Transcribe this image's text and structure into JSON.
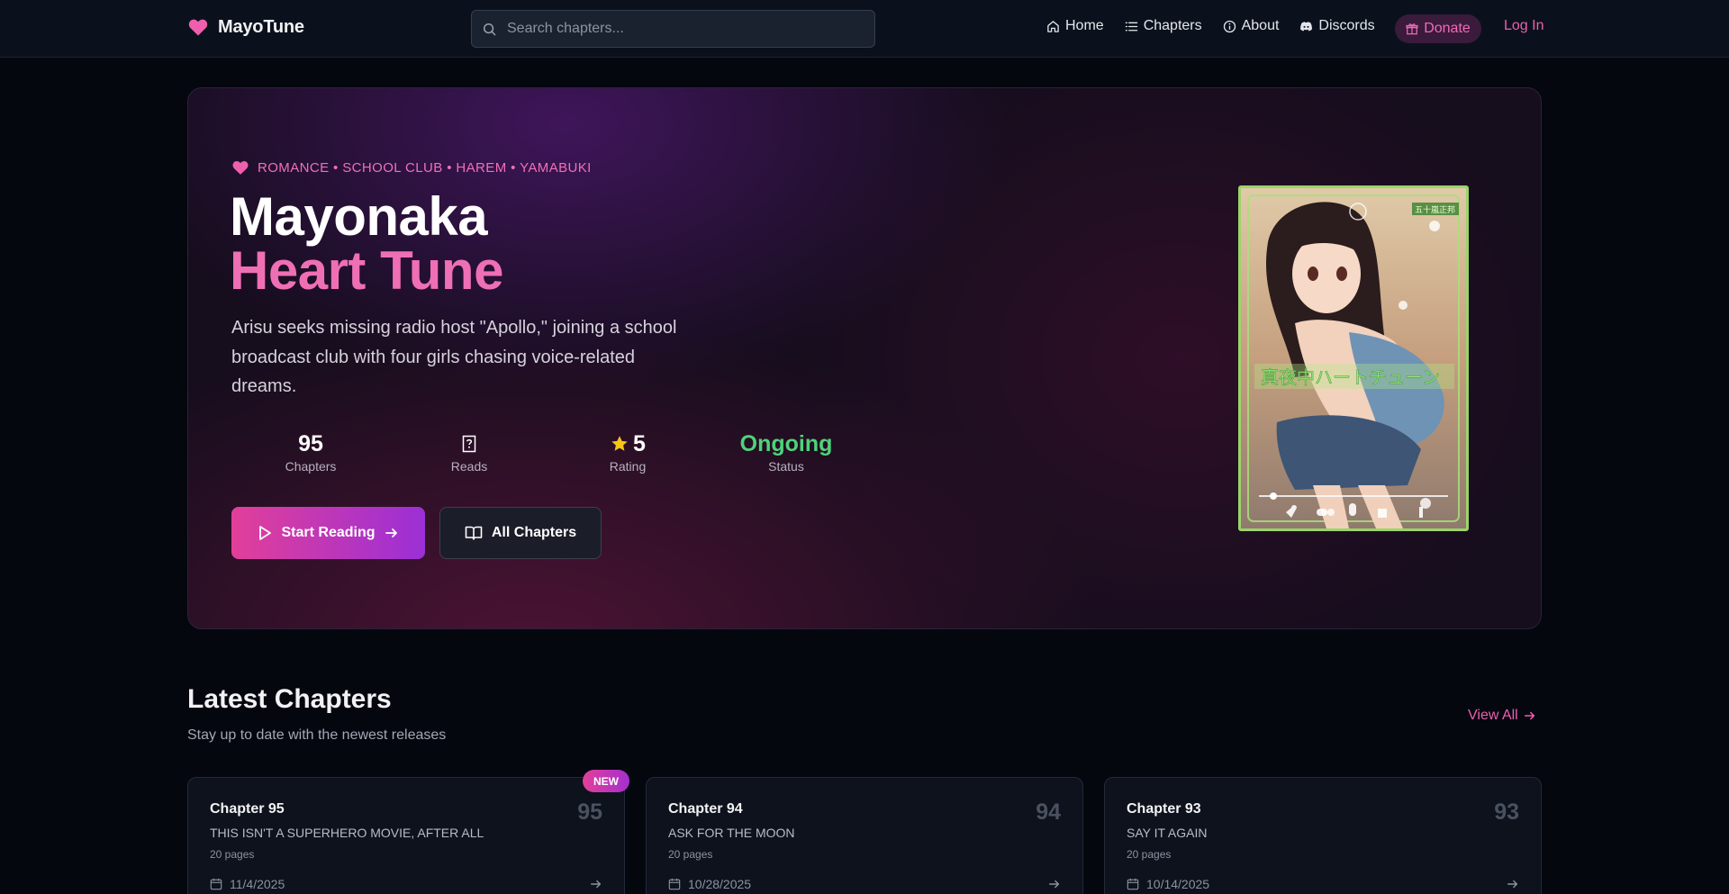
{
  "nav": {
    "logo_text": "MayoTune",
    "search_placeholder": "Search chapters...",
    "links": [
      {
        "label": "Home",
        "icon": "home-icon"
      },
      {
        "label": "Chapters",
        "icon": "list-icon"
      },
      {
        "label": "About",
        "icon": "info-icon"
      },
      {
        "label": "Discords",
        "icon": "discord-icon"
      }
    ],
    "donate_label": "Donate",
    "login_label": "Log In"
  },
  "hero": {
    "tags": "ROMANCE • SCHOOL CLUB • HAREM • YAMABUKI",
    "title_line1": "Mayonaka",
    "title_line2": "Heart Tune",
    "description": "Arisu seeks missing radio host \"Apollo,\" joining a school broadcast club with four girls chasing voice-related dreams.",
    "stats": [
      {
        "value": "95",
        "label": "Chapters"
      },
      {
        "value": "",
        "label": "Reads",
        "icon": "unknown-value-icon"
      },
      {
        "value": "5",
        "label": "Rating",
        "icon": "star-icon"
      },
      {
        "value": "Ongoing",
        "label": "Status"
      }
    ],
    "start_button": "Start Reading",
    "all_chapters_button": "All Chapters",
    "cover_text": "五十嵐正邦"
  },
  "latest": {
    "title": "Latest Chapters",
    "subtitle": "Stay up to date with the newest releases",
    "view_all": "View All",
    "new_badge": "NEW",
    "chapters": [
      {
        "title": "Chapter 95",
        "subtitle": "THIS ISN'T A SUPERHERO MOVIE, AFTER ALL",
        "pages": "20 pages",
        "number": "95",
        "date": "11/4/2025"
      },
      {
        "title": "Chapter 94",
        "subtitle": "ASK FOR THE MOON",
        "pages": "20 pages",
        "number": "94",
        "date": "10/28/2025"
      },
      {
        "title": "Chapter 93",
        "subtitle": "SAY IT AGAIN",
        "pages": "20 pages",
        "number": "93",
        "date": "10/14/2025"
      }
    ]
  },
  "colors": {
    "accent_pink": "#ef6fb5",
    "accent_purple": "#9b2fd6",
    "status_green": "#4fd27a",
    "background": "#05070f"
  }
}
